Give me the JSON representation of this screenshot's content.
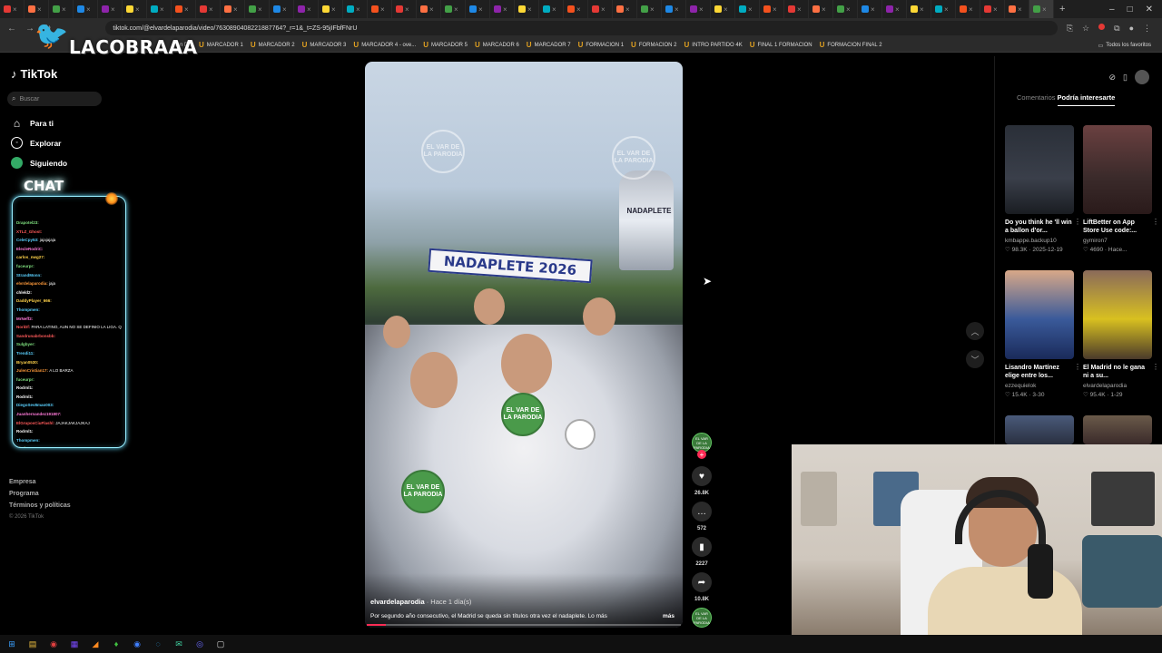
{
  "browser": {
    "tab_count": 43,
    "new_tab_label": "+",
    "url": "tiktok.com/@elvardelaparodia/video/7630890408221887764?_r=1&_t=ZS-95jIFbfFNrU",
    "window_controls": [
      "–",
      "□",
      "✕"
    ],
    "bookmarks": [
      "Gan DT",
      "MARCADOR 1",
      "MARCADOR 2",
      "MARCADOR 3",
      "MARCADOR 4 - ove...",
      "MARCADOR 5",
      "MARCADOR 6",
      "MARCADOR 7",
      "FORMACION 1",
      "FORMACION 2",
      "INTRO PARTIDO 4K",
      "FINAL 1 FORMACION",
      "FORMACION FINAL 2"
    ],
    "all_bookmarks": "Todos los favoritos"
  },
  "overlay": {
    "logo_text": "LACOBRAAA",
    "chat_title": "CHAT",
    "chat_lines": [
      {
        "user": "Drapotel23:",
        "msg": "",
        "color": "#7fe07f"
      },
      {
        "user": "XTLZ_Ghost:",
        "msg": "",
        "color": "#ff5a5a"
      },
      {
        "user": "CeleCpy53:",
        "msg": "jajajajaja",
        "color": "#5ad1ff"
      },
      {
        "user": "ElecleRodriC:",
        "msg": "",
        "color": "#ff7ad9"
      },
      {
        "user": "carlos_nwg27:",
        "msg": "",
        "color": "#ffd24a"
      },
      {
        "user": "fuceurpr:",
        "msg": "",
        "color": "#7fe07f"
      },
      {
        "user": "StrandMonn:",
        "msg": "",
        "color": "#5ad1ff"
      },
      {
        "user": "elvrdelaparodia:",
        "msg": "jaja",
        "color": "#ff9a3a"
      },
      {
        "user": "chleld2:",
        "msg": "",
        "color": "#ffffff"
      },
      {
        "user": "DaddyPlayer_666:",
        "msg": "",
        "color": "#ffd24a"
      },
      {
        "user": "Thompmen:",
        "msg": "",
        "color": "#5ad1ff"
      },
      {
        "user": "MrNeff2:",
        "msg": "",
        "color": "#ff7ad9"
      },
      {
        "user": "NoriDf:",
        "msg": "PARA LATINO, AUN NO SE DEFINIO LA LIGA. QUEDADO EN EL CLASICO",
        "color": "#ff5a5a"
      },
      {
        "user": "Sandrunabrbonsbb:",
        "msg": "",
        "color": "#ff5a5a"
      },
      {
        "user": "Sulgbyer:",
        "msg": "",
        "color": "#7fe07f"
      },
      {
        "user": "Trendi11:",
        "msg": "",
        "color": "#5ad1ff"
      },
      {
        "user": "Bryan0530:",
        "msg": "",
        "color": "#ffd24a"
      },
      {
        "user": "JulenCristian17:",
        "msg": "A LO BARZA",
        "color": "#ff9a3a"
      },
      {
        "user": "fuceurpr:",
        "msg": "",
        "color": "#7fe07f"
      },
      {
        "user": "Rodrnl1:",
        "msg": "",
        "color": "#ffffff"
      },
      {
        "user": "Rodrnl1:",
        "msg": "",
        "color": "#ffffff"
      },
      {
        "user": "DiegoSev8mao003:",
        "msg": "",
        "color": "#5ad1ff"
      },
      {
        "user": "Juanhernandez191807:",
        "msg": "",
        "color": "#ff7ad9"
      },
      {
        "user": "ElGruposCiuFlashl:",
        "msg": "JAJAKJAKJAJKAJ",
        "color": "#ff5a5a"
      },
      {
        "user": "Rodrnl1:",
        "msg": "",
        "color": "#ffffff"
      },
      {
        "user": "Thompmen:",
        "msg": "",
        "color": "#5ad1ff"
      },
      {
        "user": "Bimbo08:",
        "msg": "",
        "color": "#ffd24a"
      },
      {
        "user": "Zeuter:",
        "msg": "CONSOLA",
        "color": "#ff9a3a"
      },
      {
        "user": "Dave90:",
        "msg": "",
        "color": "#7fe07f"
      },
      {
        "user": "ElJdM_SteffZ3:",
        "msg": "",
        "color": "#ff5a5a"
      }
    ]
  },
  "tiktok": {
    "logo": "TikTok",
    "search_placeholder": "Buscar",
    "nav": [
      {
        "label": "Para ti",
        "icon": "home-icon"
      },
      {
        "label": "Explorar",
        "icon": "compass-icon"
      },
      {
        "label": "Siguiendo",
        "icon": "following-icon"
      }
    ],
    "footer": [
      "Empresa",
      "Programa",
      "Términos y políticas"
    ],
    "copyright": "© 2026 TikTok",
    "video": {
      "scarf_text": "NADAPLETE 2026",
      "trophy_text": "NADAPLETE",
      "watermark": "EL VAR DE LA PARODIA",
      "author": "elvardelaparodia",
      "time": "· Hace 1 día(s)",
      "caption": "Por segundo año consecutivo, el Madrid se queda sin títulos otra vez el nadaplete. Lo más",
      "more": "más",
      "progress": 0.06
    },
    "rail": {
      "likes": "26.8K",
      "comments": "572",
      "saves": "2227",
      "shares": "10.8K"
    },
    "panel": {
      "tabs": [
        "Comentarios",
        "Podría interesarte"
      ],
      "active_tab": 1,
      "cards": [
        {
          "title": "Do you think he 'll win a ballon d'or...",
          "account": "kmbappe.backup10",
          "likes": "98.3K",
          "date": "2025-12-19",
          "thumb": "#3a3f4a"
        },
        {
          "title": "LiftBetter on App Store Use code:...",
          "account": "gymiron7",
          "likes": "4690",
          "date": "Hace...",
          "thumb": "#5a3a3a"
        },
        {
          "title": "Lisandro Martínez elige entre los...",
          "account": "ezzequielok",
          "likes": "15.4K",
          "date": "3-30",
          "thumb": "#2a4a7a"
        },
        {
          "title": "El Madrid no le gana ni a su...",
          "account": "elvardelaparodia",
          "likes": "95.4K",
          "date": "1-29",
          "thumb": "#6a4a3a"
        }
      ]
    }
  },
  "taskbar": [
    "windows-icon",
    "files-icon",
    "chrome-icon",
    "apps-icon",
    "obs-icon",
    "game-icon",
    "chrome2-icon",
    "edge-icon",
    "chat-icon",
    "discord-icon",
    "notepad-icon"
  ]
}
